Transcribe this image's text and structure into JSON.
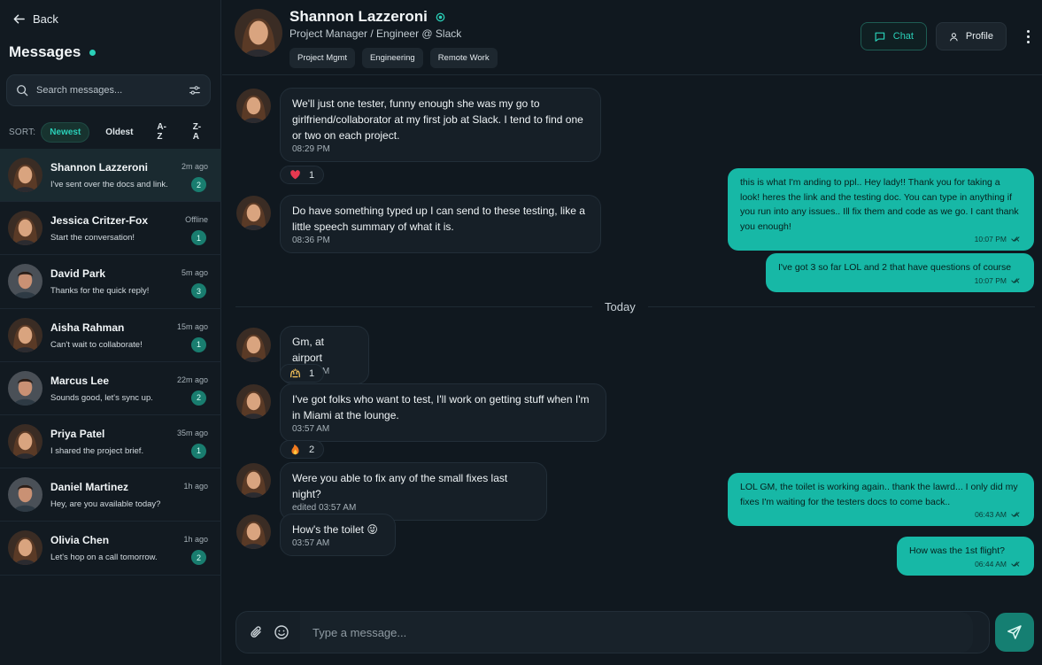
{
  "sidebar": {
    "back_label": "Back",
    "title": "Messages",
    "search_placeholder": "Search messages...",
    "sort_label": "SORT:",
    "sort_options": [
      "Newest",
      "Oldest",
      "A-Z",
      "Z-A"
    ],
    "sort_active": "Newest",
    "conversations": [
      {
        "name": "Shannon Lazzeroni",
        "preview": "I've sent over the docs and link.",
        "time": "2m ago",
        "badge": "2",
        "active": true
      },
      {
        "name": "Jessica Critzer-Fox",
        "preview": "Start the conversation!",
        "time": "Offline",
        "badge": "1"
      },
      {
        "name": "David Park",
        "preview": "Thanks for the quick reply!",
        "time": "5m ago",
        "badge": "3"
      },
      {
        "name": "Aisha Rahman",
        "preview": "Can't wait to collaborate!",
        "time": "15m ago",
        "badge": "1"
      },
      {
        "name": "Marcus Lee",
        "preview": "Sounds good, let's sync up.",
        "time": "22m ago",
        "badge": "2"
      },
      {
        "name": "Priya Patel",
        "preview": "I shared the project brief.",
        "time": "35m ago",
        "badge": "1"
      },
      {
        "name": "Daniel Martinez",
        "preview": "Hey, are you available today?",
        "time": "1h ago",
        "badge": ""
      },
      {
        "name": "Olivia Chen",
        "preview": "Let's hop on a call tomorrow.",
        "time": "1h ago",
        "badge": "2"
      }
    ]
  },
  "header": {
    "name": "Shannon Lazzeroni",
    "role": "Project Manager / Engineer @ Slack",
    "tags": [
      "Project Mgmt",
      "Engineering",
      "Remote Work"
    ],
    "chat_label": "Chat",
    "profile_label": "Profile"
  },
  "messages": {
    "divider": "Today",
    "incoming": [
      {
        "text": "We'll just one tester, funny enough she was my go to girlfriend/collaborator at my first job at Slack. I tend to find one or two on each project.",
        "time": "08:29 PM"
      },
      {
        "text": "Do have something typed up I can send to these testing, like a little speech summary of what it is.",
        "time": "08:36 PM"
      },
      {
        "text": "Gm, at airport",
        "time": "03:56 AM"
      },
      {
        "text": "I've got folks who want to test, I'll work on getting stuff when I'm in Miami at the lounge.",
        "time": "03:57 AM"
      },
      {
        "text": "Were you able to fix any of the small fixes last night?",
        "time": "edited 03:57 AM"
      },
      {
        "text": "How's the toilet 😜",
        "time": "03:57 AM"
      }
    ],
    "reactions": [
      {
        "icon": "heart-icon",
        "count": "1"
      },
      {
        "icon": "raised-hands-icon",
        "count": "1"
      },
      {
        "icon": "fire-icon",
        "count": "2"
      }
    ],
    "outgoing": [
      {
        "text": "this is what I'm anding to ppl.. Hey lady!! Thank you for taking a look! heres the link and the testing doc. You can type in anything if you run into any issues.. Ill fix them and code as we go. I cant thank you enough!",
        "time": "10:07 PM"
      },
      {
        "text": "I've got 3 so far LOL and 2 that have questions of course",
        "time": "10:07 PM"
      },
      {
        "text": "LOL GM, the toilet is working again.. thank the lawrd... I only did my fixes I'm waiting for the testers docs to come back..",
        "time": "06:43 AM"
      },
      {
        "text": "How was the 1st flight?",
        "time": "06:44 AM"
      }
    ]
  },
  "composer": {
    "placeholder": "Type a message..."
  },
  "colors": {
    "accent": "#2ad0b8",
    "outgoing_bubble": "#17b8a6",
    "background": "#10181f"
  }
}
